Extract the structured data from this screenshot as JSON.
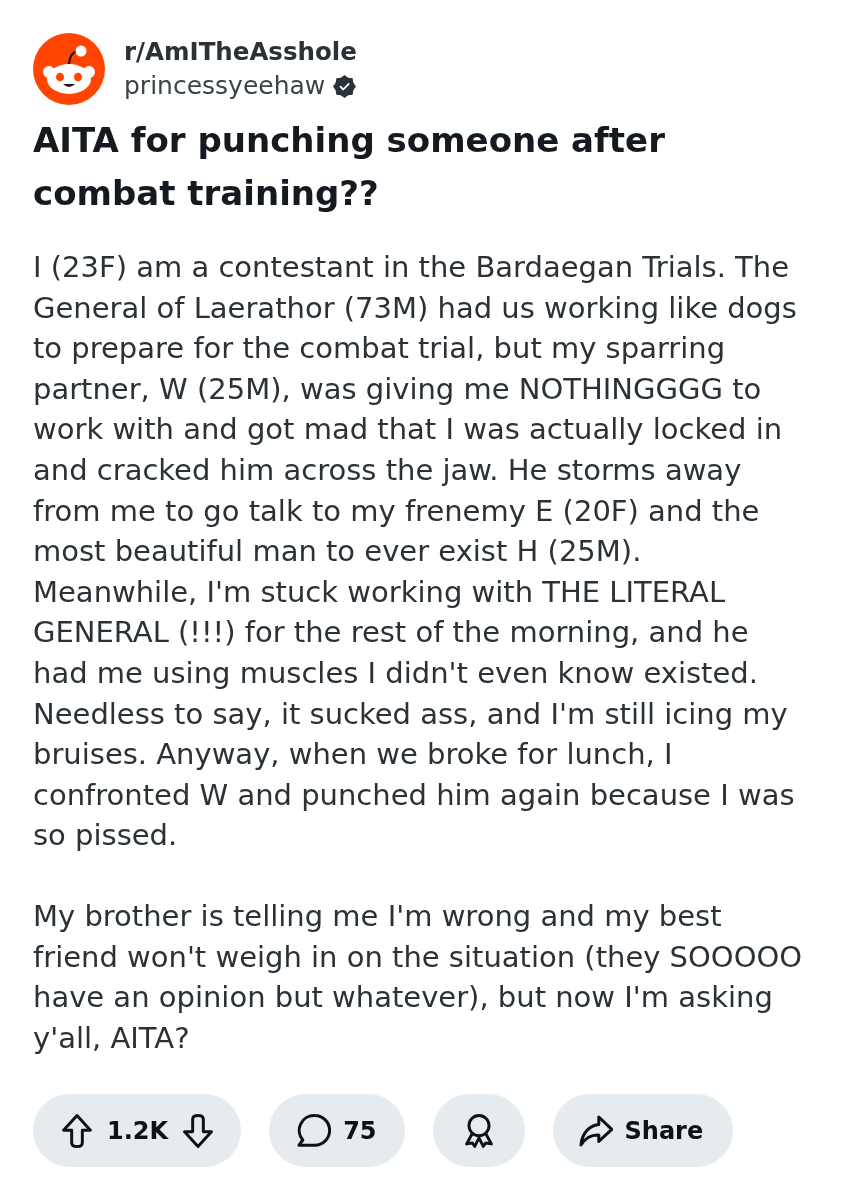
{
  "post": {
    "subreddit": "r/AmITheAsshole",
    "author": "princessyeehaw",
    "author_verified": true,
    "title": "AITA for punching someone after combat training??",
    "body": [
      "I (23F) am a contestant in the Bardaegan Trials. The General of Laerathor (73M) had us working like dogs to prepare for the combat trial, but my sparring partner, W (25M), was giving me NOTHINGGGG to work with and got mad that I was actually locked in and cracked him across the jaw. He storms away from me to go talk to my frenemy E (20F) and the most beautiful man to ever exist H (25M). Meanwhile, I'm stuck working with THE LITERAL GENERAL (!!!) for the rest of the morning, and he had me using muscles I didn't even know existed. Needless to say, it sucked ass, and I'm still icing my bruises. Anyway, when we broke for lunch, I confronted W and punched him again because I was so pissed.",
      "My brother is telling me I'm wrong and my best friend won't weigh in on the situation (they SOOOOO have an opinion but whatever), but now I'm asking y'all, AITA?"
    ]
  },
  "actions": [
    {
      "kind": "vote",
      "label": "1.2K"
    },
    {
      "kind": "comment",
      "label": "75"
    },
    {
      "kind": "award"
    },
    {
      "kind": "share",
      "label": "Share"
    }
  ]
}
